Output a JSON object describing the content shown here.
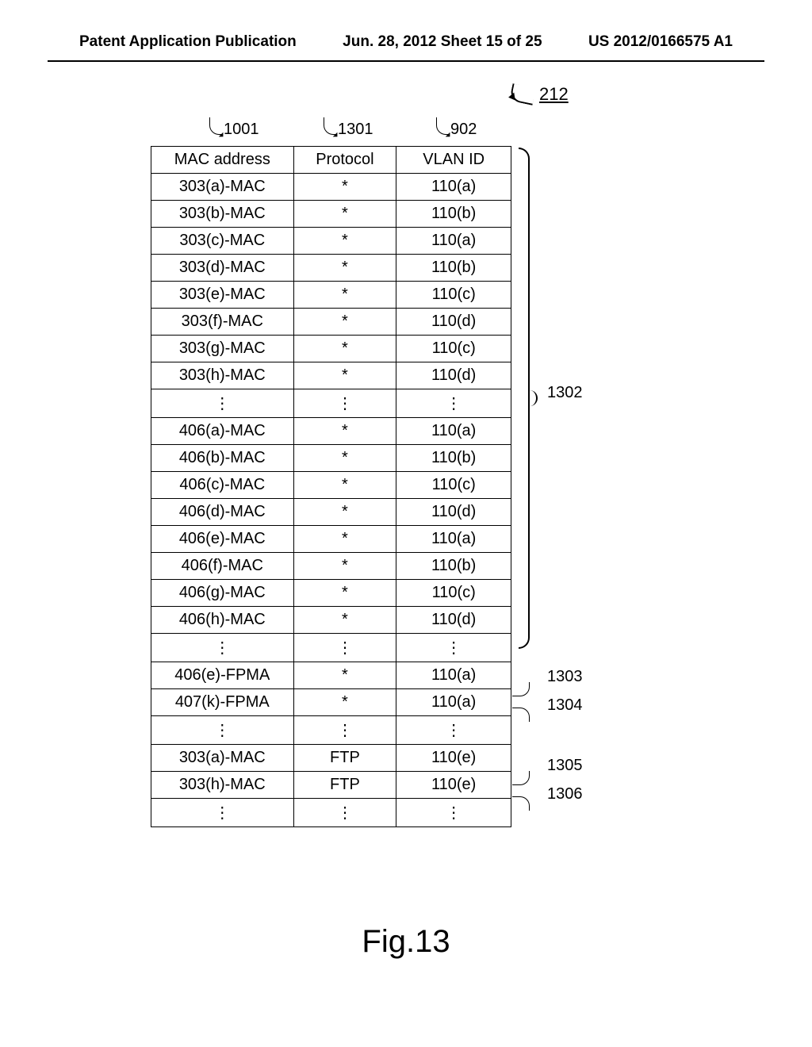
{
  "header": {
    "left": "Patent Application Publication",
    "center": "Jun. 28, 2012  Sheet 15 of 25",
    "right": "US 2012/0166575 A1"
  },
  "ref_212": "212",
  "col_refs": {
    "c1": "1001",
    "c2": "1301",
    "c3": "902"
  },
  "columns": {
    "c1": "MAC address",
    "c2": "Protocol",
    "c3": "VLAN ID"
  },
  "rows": [
    {
      "mac": "303(a)-MAC",
      "proto": "*",
      "vlan": "110(a)"
    },
    {
      "mac": "303(b)-MAC",
      "proto": "*",
      "vlan": "110(b)"
    },
    {
      "mac": "303(c)-MAC",
      "proto": "*",
      "vlan": "110(a)"
    },
    {
      "mac": "303(d)-MAC",
      "proto": "*",
      "vlan": "110(b)"
    },
    {
      "mac": "303(e)-MAC",
      "proto": "*",
      "vlan": "110(c)"
    },
    {
      "mac": "303(f)-MAC",
      "proto": "*",
      "vlan": "110(d)"
    },
    {
      "mac": "303(g)-MAC",
      "proto": "*",
      "vlan": "110(c)"
    },
    {
      "mac": "303(h)-MAC",
      "proto": "*",
      "vlan": "110(d)"
    },
    {
      "mac": "⋮",
      "proto": "⋮",
      "vlan": "⋮"
    },
    {
      "mac": "406(a)-MAC",
      "proto": "*",
      "vlan": "110(a)"
    },
    {
      "mac": "406(b)-MAC",
      "proto": "*",
      "vlan": "110(b)"
    },
    {
      "mac": "406(c)-MAC",
      "proto": "*",
      "vlan": "110(c)"
    },
    {
      "mac": "406(d)-MAC",
      "proto": "*",
      "vlan": "110(d)"
    },
    {
      "mac": "406(e)-MAC",
      "proto": "*",
      "vlan": "110(a)"
    },
    {
      "mac": "406(f)-MAC",
      "proto": "*",
      "vlan": "110(b)"
    },
    {
      "mac": "406(g)-MAC",
      "proto": "*",
      "vlan": "110(c)"
    },
    {
      "mac": "406(h)-MAC",
      "proto": "*",
      "vlan": "110(d)"
    },
    {
      "mac": "⋮",
      "proto": "⋮",
      "vlan": "⋮"
    },
    {
      "mac": "406(e)-FPMA",
      "proto": "*",
      "vlan": "110(a)"
    },
    {
      "mac": "407(k)-FPMA",
      "proto": "*",
      "vlan": "110(a)"
    },
    {
      "mac": "⋮",
      "proto": "⋮",
      "vlan": "⋮"
    },
    {
      "mac": "303(a)-MAC",
      "proto": "FTP",
      "vlan": "110(e)"
    },
    {
      "mac": "303(h)-MAC",
      "proto": "FTP",
      "vlan": "110(e)"
    },
    {
      "mac": "⋮",
      "proto": "⋮",
      "vlan": "⋮"
    }
  ],
  "row_refs": {
    "r1302": "1302",
    "r1303": "1303",
    "r1304": "1304",
    "r1305": "1305",
    "r1306": "1306"
  },
  "caption": "Fig.13"
}
